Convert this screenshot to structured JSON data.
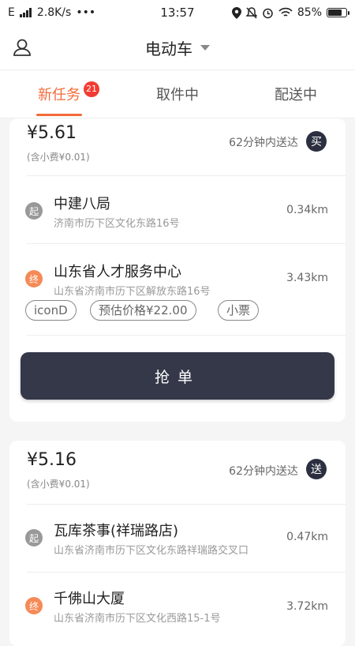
{
  "status_bar": {
    "carrier": "E",
    "speed": "2.8K/s",
    "dots": "•••",
    "time": "13:57",
    "battery_percent": "85%",
    "battery_level": 0.85
  },
  "header": {
    "title": "电动车"
  },
  "tabs": [
    {
      "label": "新任务",
      "badge": "21"
    },
    {
      "label": "取件中"
    },
    {
      "label": "配送中"
    }
  ],
  "orders": [
    {
      "price": "¥5.61",
      "tip": "(含小费¥0.01)",
      "eta": "62分钟内送达",
      "type_mark": "买",
      "pickup": {
        "mark": "起",
        "name": "中建八局",
        "address": "济南市历下区文化东路16号",
        "distance": "0.34km"
      },
      "dropoff": {
        "mark": "终",
        "name": "山东省人才服务中心",
        "address": "山东省济南市历下区解放东路16号",
        "distance": "3.43km"
      },
      "tags": [
        "iconD",
        "预估价格¥22.00",
        "小票"
      ],
      "grab_label": "抢单"
    },
    {
      "price": "¥5.16",
      "tip": "(含小费¥0.01)",
      "eta": "62分钟内送达",
      "type_mark": "送",
      "pickup": {
        "mark": "起",
        "name": "瓦库茶事(祥瑞路店)",
        "address": "山东省济南市历下区文化东路祥瑞路交叉口",
        "distance": "0.47km"
      },
      "dropoff": {
        "mark": "终",
        "name": "千佛山大厦",
        "address": "山东省济南市历下区文化西路15-1号",
        "distance": "3.72km"
      }
    }
  ]
}
